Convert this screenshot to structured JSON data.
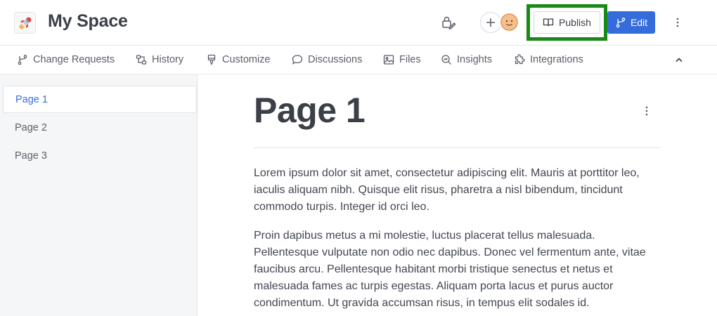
{
  "header": {
    "space_icon": "rocket-emoji",
    "space_title": "My Space",
    "publish_label": "Publish",
    "edit_label": "Edit",
    "icons": [
      "lock-edit-icon",
      "plus-icon",
      "avatar",
      "book-icon",
      "branch-icon",
      "more-vertical-icon"
    ]
  },
  "tabs": [
    {
      "label": "Change Requests",
      "icon": "branch-icon"
    },
    {
      "label": "History",
      "icon": "history-icon"
    },
    {
      "label": "Customize",
      "icon": "brush-icon"
    },
    {
      "label": "Discussions",
      "icon": "chat-icon"
    },
    {
      "label": "Files",
      "icon": "image-icon"
    },
    {
      "label": "Insights",
      "icon": "insights-icon"
    },
    {
      "label": "Integrations",
      "icon": "puzzle-icon"
    }
  ],
  "sidebar": {
    "pages": [
      {
        "label": "Page 1",
        "active": true
      },
      {
        "label": "Page 2",
        "active": false
      },
      {
        "label": "Page 3",
        "active": false
      }
    ]
  },
  "main": {
    "title": "Page 1",
    "paragraphs": [
      "Lorem ipsum dolor sit amet, consectetur adipiscing elit. Mauris at porttitor leo, iaculis aliquam nibh. Quisque elit risus, pharetra a nisl bibendum, tincidunt commodo turpis. Integer id orci leo.",
      "Proin dapibus metus a mi molestie, luctus placerat tellus malesuada. Pellentesque vulputate non odio nec dapibus. Donec vel fermentum ante, vitae faucibus arcu. Pellentesque habitant morbi tristique senectus et netus et malesuada fames ac turpis egestas. Aliquam porta lacus et purus auctor condimentum. Ut gravida accumsan risus, in tempus elit sodales id."
    ]
  },
  "colors": {
    "accent": "#346ddb",
    "highlight_border": "#1a8a17",
    "active_page": "#3b6fd8",
    "sidebar_bg": "#f5f6f7"
  }
}
